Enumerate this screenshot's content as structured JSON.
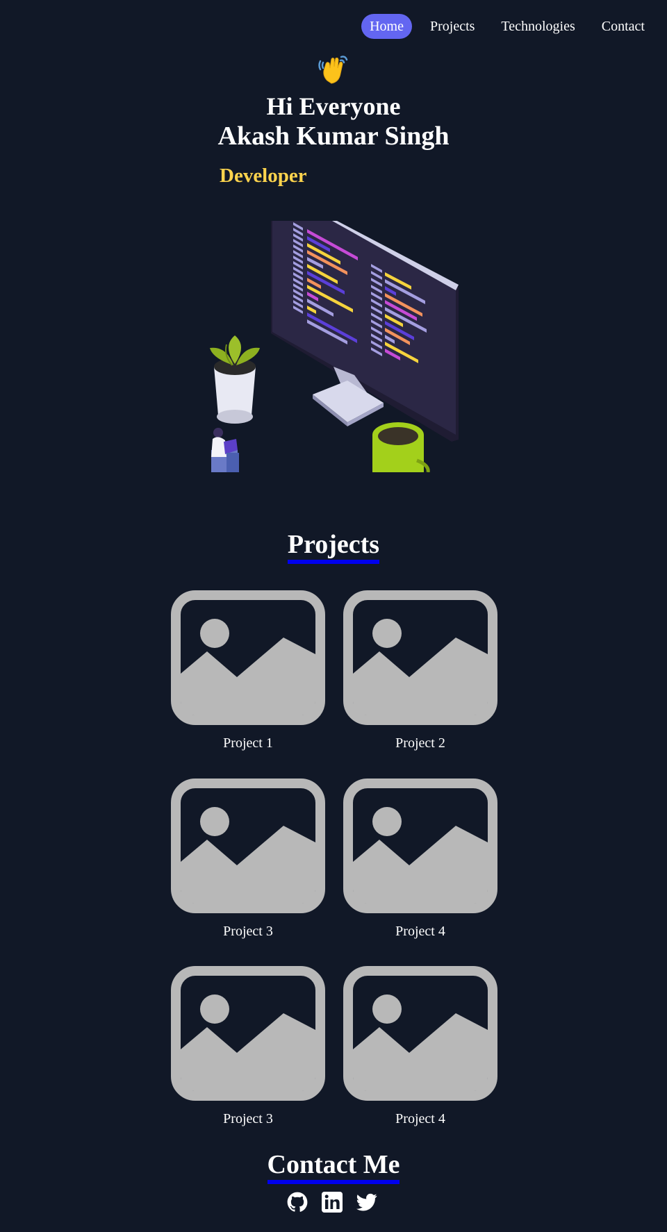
{
  "nav": {
    "items": [
      {
        "label": "Home",
        "active": true
      },
      {
        "label": "Projects",
        "active": false
      },
      {
        "label": "Technologies",
        "active": false
      },
      {
        "label": "Contact",
        "active": false
      }
    ],
    "active_color": "#6366f1"
  },
  "hero": {
    "wave_icon": "waving-hand-icon",
    "greeting": "Hi Everyone",
    "name": "Akash Kumar Singh",
    "role": "Developer",
    "role_color": "#fcd34d",
    "illustration": "developer-workspace-illustration"
  },
  "projects": {
    "title": "Projects",
    "items": [
      {
        "label": "Project 1",
        "icon": "image-placeholder-icon"
      },
      {
        "label": "Project 2",
        "icon": "image-placeholder-icon"
      },
      {
        "label": "Project 3",
        "icon": "image-placeholder-icon"
      },
      {
        "label": "Project 4",
        "icon": "image-placeholder-icon"
      },
      {
        "label": "Project 3",
        "icon": "image-placeholder-icon"
      },
      {
        "label": "Project 4",
        "icon": "image-placeholder-icon"
      }
    ]
  },
  "contact": {
    "title": "Contact Me",
    "socials": [
      {
        "icon": "github-icon"
      },
      {
        "icon": "linkedin-icon"
      },
      {
        "icon": "twitter-icon"
      }
    ]
  },
  "colors": {
    "background": "#111827",
    "underline": "#0000ee",
    "placeholder": "#b8b8b8"
  }
}
